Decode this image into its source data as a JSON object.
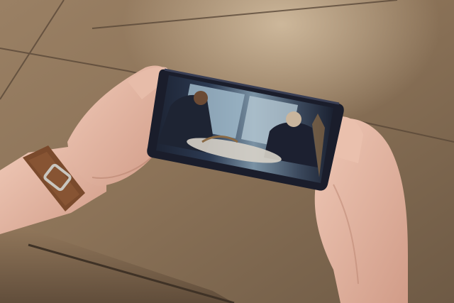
{
  "scene": {
    "description_free": true,
    "colors": {
      "table_surface": "#8c7358",
      "table_highlight": "#b39877",
      "table_shadow": "#4e3f31",
      "tile_seam": "#5a4838",
      "skin": "#e3b7a4",
      "skin_shadow": "#c48f7c",
      "watch_strap": "#7a4a2c",
      "watch_strap_dark": "#5a331d",
      "watch_buckle": "#c9c6bf",
      "phone_body": "#1a1d2b",
      "phone_edge": "#3a3f55",
      "video_window_light": "#9fb9c9",
      "video_dark": "#1e2433",
      "video_warm": "#8a6a45"
    },
    "phone": {
      "orientation": "landscape",
      "screen_content": "video-playback"
    }
  }
}
